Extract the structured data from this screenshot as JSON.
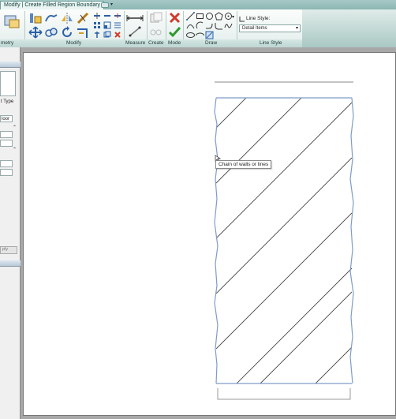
{
  "tab": {
    "title": "Modify | Create Filled Region Boundary"
  },
  "ribbon": {
    "panels": {
      "geometry": "metry",
      "modify": "Modify",
      "measure": "Measure",
      "create": "Create",
      "mode": "Mode",
      "draw": "Draw",
      "line_style": "Line Style"
    },
    "line_style_label": "Line Style:",
    "line_style_value": "Detail Items",
    "colors": {
      "finish": "#2e9a2e",
      "cancel": "#d23a2a",
      "accent": "#2a5fa8"
    }
  },
  "sidebar": {
    "type_label": "t Type",
    "floor_label": "loor",
    "apply_label": "ply"
  },
  "tooltip": {
    "text": "Chain of walls or lines"
  }
}
